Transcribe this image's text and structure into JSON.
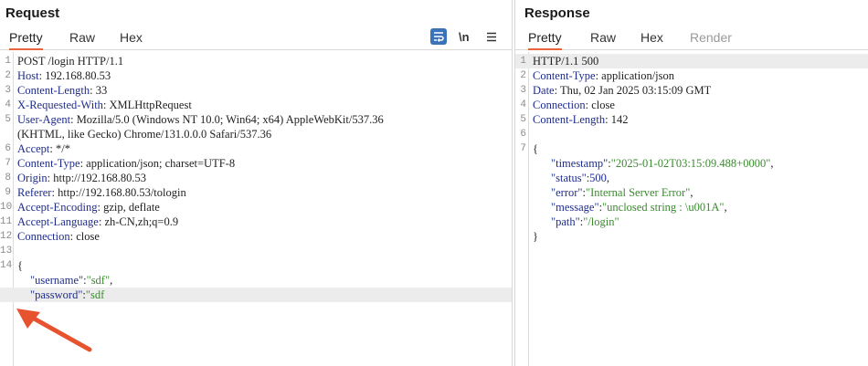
{
  "request": {
    "title": "Request",
    "tabs": [
      "Pretty",
      "Raw",
      "Hex"
    ],
    "wrap_icon": "text-wrap-icon",
    "newline_label": "\\n",
    "menu_icon": "hamburger-menu-icon",
    "lines": [
      {
        "n": "1",
        "t": "POST /login HTTP/1.1"
      },
      {
        "n": "2",
        "k": "Host",
        "v": " 192.168.80.53"
      },
      {
        "n": "3",
        "k": "Content-Length",
        "v": " 33"
      },
      {
        "n": "4",
        "k": "X-Requested-With",
        "v": " XMLHttpRequest"
      },
      {
        "n": "5",
        "k": "User-Agent",
        "v": " Mozilla/5.0 (Windows NT 10.0; Win64; x64) AppleWebKit/537.36"
      },
      {
        "n": "",
        "t": "(KHTML, like Gecko) Chrome/131.0.0.0 Safari/537.36"
      },
      {
        "n": "6",
        "k": "Accept",
        "v": " */*"
      },
      {
        "n": "7",
        "k": "Content-Type",
        "v": " application/json; charset=UTF-8"
      },
      {
        "n": "8",
        "k": "Origin",
        "v": " http://192.168.80.53"
      },
      {
        "n": "9",
        "k": "Referer",
        "v": " http://192.168.80.53/tologin"
      },
      {
        "n": "10",
        "k": "Accept-Encoding",
        "v": " gzip, deflate"
      },
      {
        "n": "11",
        "k": "Accept-Language",
        "v": " zh-CN,zh;q=0.9"
      },
      {
        "n": "12",
        "k": "Connection",
        "v": " close"
      },
      {
        "n": "13",
        "t": ""
      },
      {
        "n": "14",
        "t": "{"
      },
      {
        "n": "",
        "jk": "\"username\"",
        "js": "\"sdf\"",
        "tail": ","
      },
      {
        "n": "",
        "jk": "\"password\"",
        "js": "\"sdf",
        "tail": "",
        "hl": true
      }
    ]
  },
  "response": {
    "title": "Response",
    "tabs": [
      "Pretty",
      "Raw",
      "Hex",
      "Render"
    ],
    "lines": [
      {
        "n": "1",
        "t": "HTTP/1.1 500",
        "hl": true
      },
      {
        "n": "2",
        "k": "Content-Type",
        "v": " application/json"
      },
      {
        "n": "3",
        "k": "Date",
        "v": " Thu, 02 Jan 2025 03:15:09 GMT"
      },
      {
        "n": "4",
        "k": "Connection",
        "v": " close"
      },
      {
        "n": "5",
        "k": "Content-Length",
        "v": " 142"
      },
      {
        "n": "6",
        "t": ""
      },
      {
        "n": "7",
        "t": "{"
      },
      {
        "n": "",
        "jk": "\"timestamp\"",
        "js": "\"2025-01-02T03:15:09.488+0000\"",
        "tail": ","
      },
      {
        "n": "",
        "jk": "\"status\"",
        "jn": "500",
        "tail": ","
      },
      {
        "n": "",
        "jk": "\"error\"",
        "js": "\"Internal Server Error\"",
        "tail": ","
      },
      {
        "n": "",
        "jk": "\"message\"",
        "js": "\"unclosed string : \\u001A\"",
        "tail": ","
      },
      {
        "n": "",
        "jk": "\"path\"",
        "js": "\"/login\"",
        "tail": ""
      },
      {
        "n": "",
        "t": "}"
      }
    ]
  },
  "colors": {
    "accent": "#e8663d",
    "key": "#1e2d8c",
    "string": "#3a8a2f",
    "wrap_button": "#3b73b9"
  }
}
